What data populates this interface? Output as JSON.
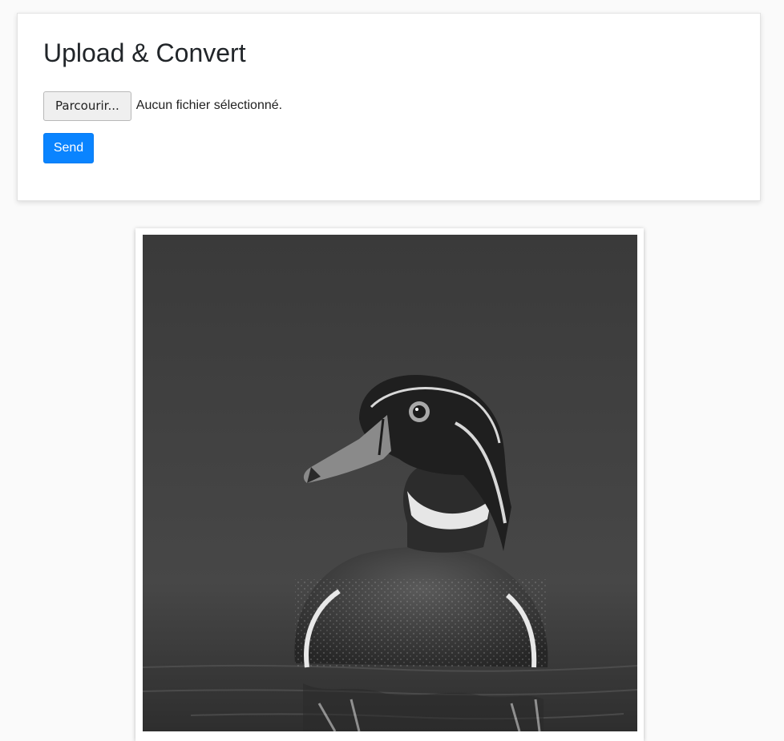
{
  "upload_form": {
    "title": "Upload & Convert",
    "browse_label": "Parcourir...",
    "file_status": "Aucun fichier sélectionné.",
    "send_label": "Send"
  },
  "result": {
    "image_subject": "wood-duck-grayscale-photo"
  },
  "colors": {
    "page_background": "#fafafa",
    "card_background": "#ffffff",
    "primary_button": "#0a84ff",
    "browse_button": "#efefef"
  }
}
